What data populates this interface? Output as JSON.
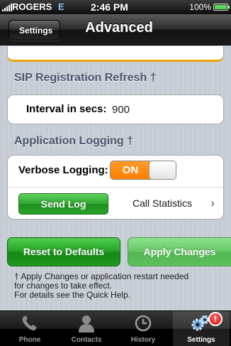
{
  "status_bar": {
    "carrier": "ROGERS",
    "network": "E",
    "time": "2:46 PM",
    "battery_percent": "100%",
    "battery_level": 1.0
  },
  "nav": {
    "back_label": "Settings",
    "title": "Advanced"
  },
  "sip": {
    "header": "SIP Registration Refresh †",
    "interval_label": "Interval in secs:",
    "interval_value": "900"
  },
  "logging": {
    "header": "Application Logging †",
    "verbose_label": "Verbose Logging:",
    "verbose_state": "ON",
    "send_log_label": "Send Log",
    "call_stats_label": "Call Statistics",
    "chevron": "›"
  },
  "actions": {
    "reset_label": "Reset to Defaults",
    "apply_label": "Apply Changes"
  },
  "footnote": {
    "line1": "† Apply Changes or application restart needed",
    "line2": "for changes to take effect.",
    "line3": "For details see the Quick Help."
  },
  "tabs": [
    {
      "label": "Phone",
      "icon": "phone-icon",
      "active": false
    },
    {
      "label": "Contacts",
      "icon": "contacts-icon",
      "active": false
    },
    {
      "label": "History",
      "icon": "history-clock-icon",
      "active": false
    },
    {
      "label": "Settings",
      "icon": "settings-gears-icon",
      "active": true,
      "badge": "!"
    }
  ],
  "colors": {
    "toggle_on": "#ff8200",
    "button_green": "#23a023",
    "section_header": "#4c566c",
    "badge_red": "#d60000"
  }
}
